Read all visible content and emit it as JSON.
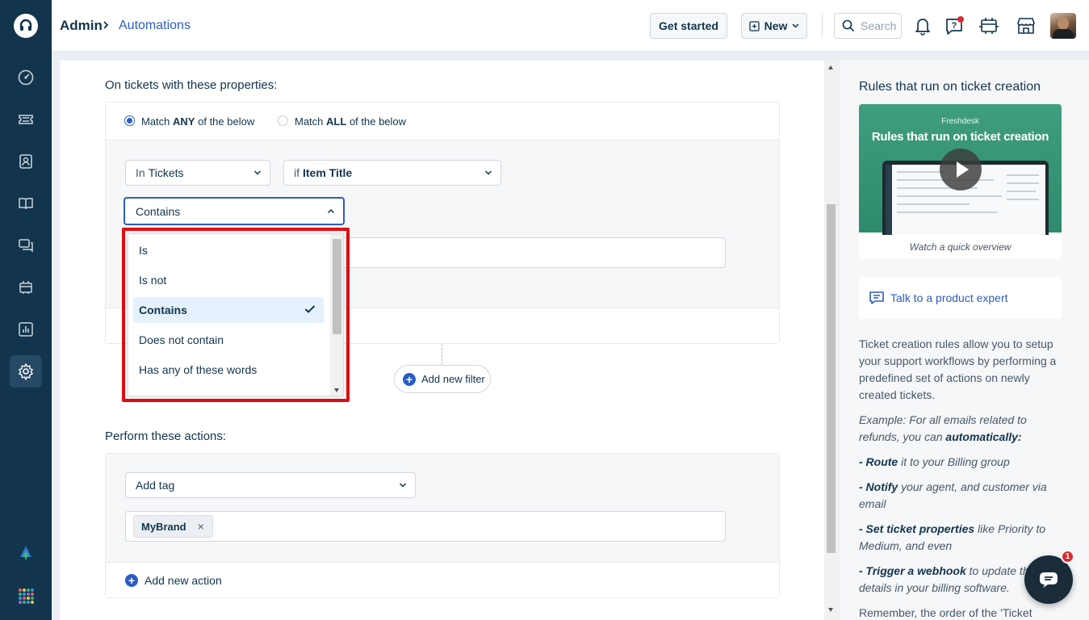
{
  "header": {
    "breadcrumb_root": "Admin",
    "breadcrumb_current": "Automations",
    "get_started_label": "Get started",
    "new_label": "New",
    "search_placeholder": "Search"
  },
  "conditions": {
    "section_title": "On tickets with these properties:",
    "match_any_prefix": "Match",
    "match_any_bold": "ANY",
    "match_any_suffix": "of the below",
    "match_all_prefix": "Match",
    "match_all_bold": "ALL",
    "match_all_suffix": "of the below",
    "selected_match": "any",
    "entity_prefix": "In",
    "entity_value": "Tickets",
    "field_prefix": "if",
    "field_value": "Item Title",
    "operator_value": "Contains",
    "add_filter_label": "Add new filter"
  },
  "operator_dropdown": {
    "options": [
      "Is",
      "Is not",
      "Contains",
      "Does not contain",
      "Has any of these words"
    ],
    "selected": "Contains"
  },
  "actions": {
    "section_title": "Perform these actions:",
    "action_value": "Add tag",
    "tags": [
      "MyBrand"
    ],
    "tag_remove": "×",
    "add_action_label": "Add new action"
  },
  "sidebar": {
    "title": "Rules that run on ticket creation",
    "video_brand": "Freshdesk",
    "video_title": "Rules that run on ticket creation",
    "video_caption": "Watch a quick overview",
    "talk_expert": "Talk to a product expert",
    "description": "Ticket creation rules allow you to setup your support workflows by performing a predefined set of actions on newly created tickets.",
    "example_prefix": "Example: For all emails related to refunds, you can ",
    "example_bold": "automatically:",
    "bullet1_bold": "- Route",
    "bullet1_rest": " it to your Billing group",
    "bullet2_bold": "- Notify",
    "bullet2_rest": " your agent, and customer via email",
    "bullet3_bold": "- Set ticket properties",
    "bullet3_rest": " like Priority to Medium, and even",
    "bullet4_bold": "- Trigger a webhook",
    "bullet4_rest": " to update the details in your billing software.",
    "remember": "Remember, the order of the 'Ticket"
  },
  "chat": {
    "badge_count": "1"
  },
  "colors": {
    "nav_bg": "#12344d",
    "accent": "#2c5cc5",
    "highlight": "#e00c12"
  }
}
